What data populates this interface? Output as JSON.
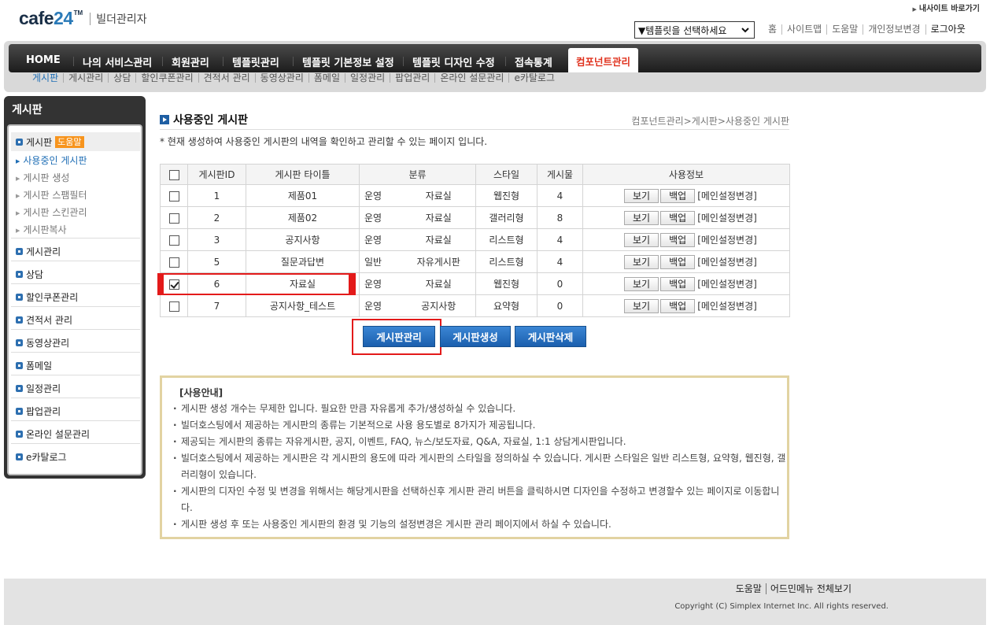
{
  "brand": {
    "logo_text": "cafe24",
    "logo_tm": "TM",
    "product": "빌더관리자"
  },
  "header": {
    "mysite_link": "내사이트 바로가기",
    "template_select": "▼템플릿을 선택하세요",
    "util_links": [
      "홈",
      "사이트맵",
      "도움말",
      "개인정보변경",
      "로그아웃"
    ]
  },
  "gnb": {
    "items": [
      "HOME",
      "나의 서비스관리",
      "회원관리",
      "템플릿관리",
      "템플릿 기본정보 설정",
      "템플릿 디자인 수정",
      "접속통계",
      "컴포넌트관리"
    ],
    "active_index": 7,
    "sub_items": [
      "게시판",
      "게시관리",
      "상담",
      "할인쿠폰관리",
      "견적서 관리",
      "동영상관리",
      "폼메일",
      "일정관리",
      "팝업관리",
      "온라인 설문관리",
      "e카탈로그"
    ]
  },
  "sidebar": {
    "title": "게시판",
    "first_section": {
      "label": "게시판",
      "badge": "도움말"
    },
    "sub_items": [
      "사용중인 게시판",
      "게시판 생성",
      "게시판 스팸필터",
      "게시판 스킨관리",
      "게시판복사"
    ],
    "active_sub_index": 0,
    "sections": [
      "게시관리",
      "상담",
      "할인쿠폰관리",
      "견적서 관리",
      "동영상관리",
      "폼메일",
      "일정관리",
      "팝업관리",
      "온라인 설문관리",
      "e카탈로그"
    ]
  },
  "content": {
    "title": "사용중인 게시판",
    "breadcrumb": "컴포넌트관리>게시판>사용중인 게시판",
    "description": "* 현재 생성하여 사용중인 게시판의 내역을 확인하고 관리할 수 있는 페이지 입니다.",
    "table": {
      "headers": [
        "게시판ID",
        "게시판 타이틀",
        "분류",
        "스타일",
        "게시물",
        "사용정보"
      ],
      "view_label": "보기",
      "backup_label": "백업",
      "main_setting_label": "[메인설정변경]",
      "rows": [
        {
          "id": "1",
          "title": "제품01",
          "cat_a": "운영",
          "cat_b": "자료실",
          "style": "웹진형",
          "count": "4",
          "checked": false
        },
        {
          "id": "2",
          "title": "제품02",
          "cat_a": "운영",
          "cat_b": "자료실",
          "style": "갤러리형",
          "count": "8",
          "checked": false
        },
        {
          "id": "3",
          "title": "공지사항",
          "cat_a": "운영",
          "cat_b": "자료실",
          "style": "리스트형",
          "count": "4",
          "checked": false
        },
        {
          "id": "5",
          "title": "질문과답변",
          "cat_a": "일반",
          "cat_b": "자유게시판",
          "style": "리스트형",
          "count": "4",
          "checked": false
        },
        {
          "id": "6",
          "title": "자료실",
          "cat_a": "운영",
          "cat_b": "자료실",
          "style": "웹진형",
          "count": "0",
          "checked": true
        },
        {
          "id": "7",
          "title": "공지사항_테스트",
          "cat_a": "운영",
          "cat_b": "공지사항",
          "style": "요약형",
          "count": "0",
          "checked": false
        }
      ]
    },
    "buttons": {
      "manage": "게시판관리",
      "create": "게시판생성",
      "delete": "게시판삭제"
    },
    "notice": {
      "title": "[사용안내]",
      "lines": [
        "게시판 생성 개수는 무제한 입니다. 필요한 만큼 자유롭게 추가/생성하실 수 있습니다.",
        "빌더호스팅에서 제공하는 게시판의 종류는 기본적으로 사용 용도별로 8가지가 제공됩니다.",
        "제공되는 게시판의 종류는 자유게시판, 공지, 이벤트, FAQ, 뉴스/보도자료, Q&A, 자료실, 1:1 상담게시판입니다.",
        "빌더호스팅에서 제공하는 게시판은 각 게시판의 용도에 따라 게시판의 스타일을 정의하실 수 있습니다. 게시판 스타일은 일반 리스트형, 요약형, 웹진형, 갤러리형이 있습니다.",
        "게시판의 디자인 수정 및 변경을 위해서는 해당게시판을 선택하신후 게시판 관리 버튼을 클릭하시면 디자인을 수정하고 변경할수 있는 페이지로 이동합니다.",
        "게시판 생성 후 또는 사용중인 게시판의 환경 및 기능의 설정변경은 게시판 관리 페이지에서 하실 수 있습니다."
      ]
    }
  },
  "footer": {
    "links": [
      "도움말",
      "어드민메뉴 전체보기"
    ],
    "copyright": "Copyright (C) Simplex Internet Inc. All rights reserved."
  }
}
